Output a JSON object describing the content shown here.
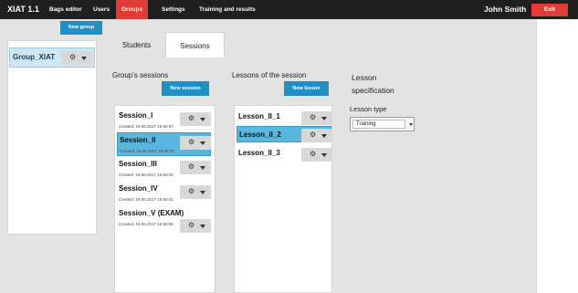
{
  "app": {
    "title": "XIAT 1.1"
  },
  "nav": {
    "items": [
      {
        "label": "Bags editor"
      },
      {
        "label": "Users"
      },
      {
        "label": "Groups"
      },
      {
        "label": "Settings"
      },
      {
        "label": "Training and results"
      }
    ],
    "active_index": 2
  },
  "user": {
    "name": "John Smith",
    "exit_label": "Exit"
  },
  "groups": {
    "new_label": "New group",
    "items": [
      {
        "name": "Group_XIAT",
        "menu_icon": "gear-icon"
      }
    ]
  },
  "tabs": [
    {
      "label": "Students"
    },
    {
      "label": "Sessions"
    }
  ],
  "active_tab": 1,
  "sessions": {
    "title": "Group's sessions",
    "new_label": "New session",
    "items": [
      {
        "name": "Session_I",
        "created": "Created: 19.06.2017 15:50:57"
      },
      {
        "name": "Session_II",
        "created": "Created: 19.06.2017 15:50:03"
      },
      {
        "name": "Session_III",
        "created": "Created: 19.06.2017 15:50:32"
      },
      {
        "name": "Session_IV",
        "created": "Created: 19.06.2017 15:50:42"
      },
      {
        "name": "Session_V (EXAM)",
        "created": "Created: 19.06.2017 15:50:55"
      }
    ],
    "selected_index": 1
  },
  "lessons": {
    "title": "Lessons of the session",
    "new_label": "New lesson",
    "items": [
      {
        "name": "Lesson_II_1"
      },
      {
        "name": "Lesson_II_2"
      },
      {
        "name": "Lesson_II_3"
      }
    ],
    "selected_index": 1
  },
  "spec": {
    "title": "Lesson specification",
    "type_label": "Lesson type",
    "type_value": "Training"
  },
  "icons": {
    "menu": "⚙",
    "chevron": "chevron-down-icon"
  },
  "colors": {
    "topbar": "#1f1f1f",
    "accent_red": "#e23b36",
    "accent_blue": "#1f8fc4",
    "selected": "#5bb6df"
  }
}
